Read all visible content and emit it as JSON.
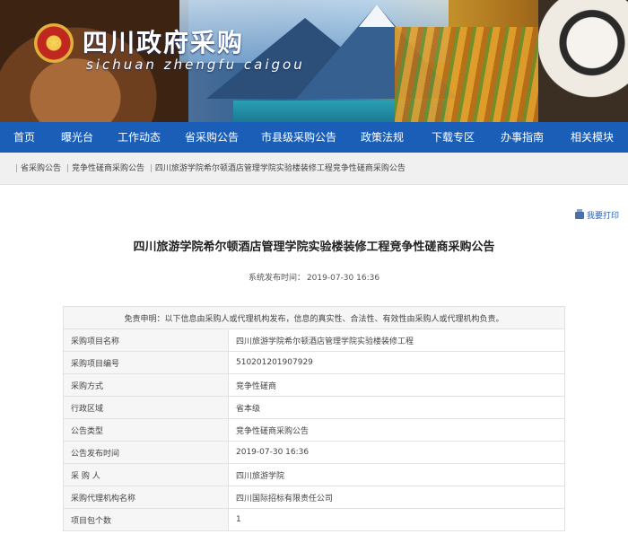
{
  "header": {
    "title": "四川政府采购",
    "subtitle": "sichuan  zhengfu  caigou"
  },
  "nav": [
    "首页",
    "曝光台",
    "工作动态",
    "省采购公告",
    "市县级采购公告",
    "政策法规",
    "下载专区",
    "办事指南",
    "相关模块"
  ],
  "breadcrumb": [
    "省采购公告",
    "竞争性磋商采购公告",
    "四川旅游学院希尔顿酒店管理学院实验楼装修工程竞争性磋商采购公告"
  ],
  "print_label": "我要打印",
  "article": {
    "title": "四川旅游学院希尔顿酒店管理学院实验楼装修工程竞争性磋商采购公告",
    "publish_label": "系统发布时间：",
    "publish_time": "2019-07-30 16:36"
  },
  "notice": "免责申明：以下信息由采购人或代理机构发布，信息的真实性、合法性、有效性由采购人或代理机构负责。",
  "rows": [
    {
      "label": "采购项目名称",
      "value": "四川旅游学院希尔顿酒店管理学院实验楼装修工程"
    },
    {
      "label": "采购项目编号",
      "value": "510201201907929"
    },
    {
      "label": "采购方式",
      "value": "竞争性磋商"
    },
    {
      "label": "行政区域",
      "value": "省本级"
    },
    {
      "label": "公告类型",
      "value": "竞争性磋商采购公告"
    },
    {
      "label": "公告发布时间",
      "value": "2019-07-30 16:36"
    },
    {
      "label": "采 购 人",
      "value": "四川旅游学院"
    },
    {
      "label": "采购代理机构名称",
      "value": "四川国际招标有限责任公司"
    },
    {
      "label": "项目包个数",
      "value": "1"
    }
  ]
}
